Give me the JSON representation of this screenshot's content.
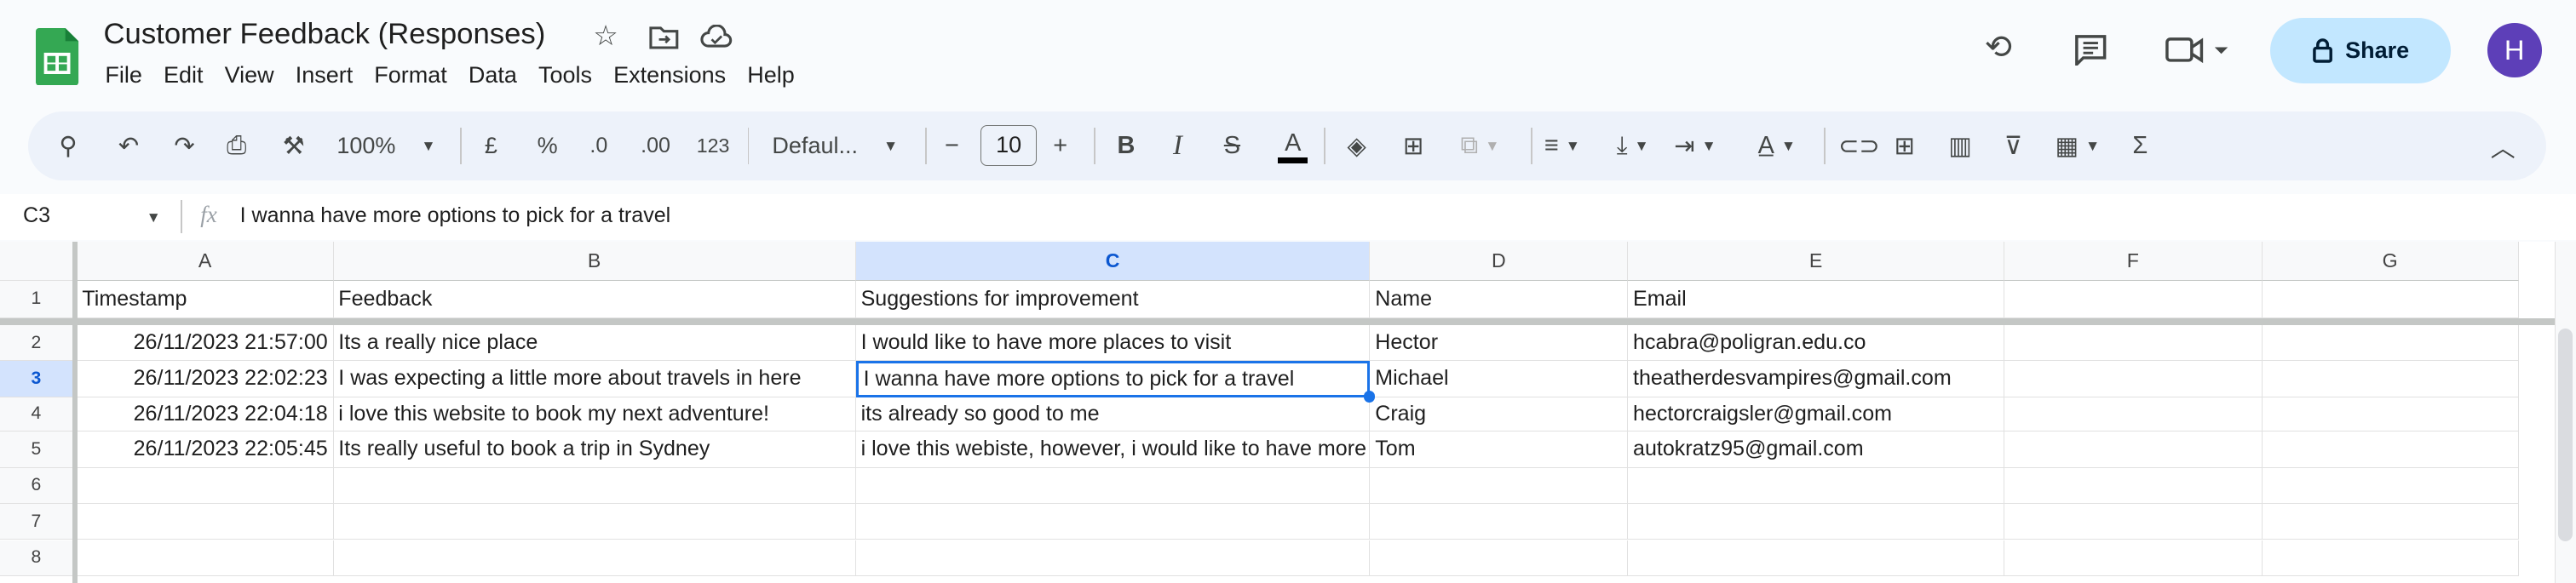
{
  "app": {
    "title": "Customer Feedback (Responses)",
    "menu": [
      "File",
      "Edit",
      "View",
      "Insert",
      "Format",
      "Data",
      "Tools",
      "Extensions",
      "Help"
    ],
    "share_label": "Share",
    "avatar_initial": "H",
    "brand_color": "#34a853",
    "share_bg": "#c2e7ff",
    "avatar_color": "#5d3fb8"
  },
  "toolbar": {
    "zoom": "100%",
    "currency": "£",
    "percent": "%",
    "decrease_decimal": ".0",
    "increase_decimal": ".00",
    "number_format": "123",
    "font": "Defaul...",
    "font_size": "10",
    "bold": "B",
    "italic": "I",
    "strikethrough": "S",
    "text_color": "A",
    "sum": "Σ"
  },
  "formula_bar": {
    "cell_ref": "C3",
    "fx": "fx",
    "value": "I wanna have more options to pick for a travel"
  },
  "sheet": {
    "columns": [
      "A",
      "B",
      "C",
      "D",
      "E",
      "F",
      "G"
    ],
    "selected_column": "C",
    "selected_row": 3,
    "row_numbers": [
      "1",
      "2",
      "3",
      "4",
      "5",
      "6",
      "7",
      "8"
    ],
    "rows": [
      [
        "Timestamp",
        "Feedback",
        "Suggestions for improvement",
        "Name",
        "Email",
        "",
        ""
      ],
      [
        "26/11/2023 21:57:00",
        "Its a really nice place",
        "I would like to have more places to visit",
        "Hector",
        "hcabra@poligran.edu.co",
        "",
        ""
      ],
      [
        "26/11/2023 22:02:23",
        "I was expecting a little more about travels in here",
        "I wanna have more options to pick for a travel",
        "Michael",
        "theatherdesvampires@gmail.com",
        "",
        ""
      ],
      [
        "26/11/2023 22:04:18",
        "i love this website to book my next adventure!",
        "its already so good to me",
        "Craig",
        "hectorcraigsler@gmail.com",
        "",
        ""
      ],
      [
        "26/11/2023 22:05:45",
        "Its really useful to book a trip in Sydney",
        "i love this webiste, however, i would like to have more",
        "Tom",
        "autokratz95@gmail.com",
        "",
        ""
      ],
      [
        "",
        "",
        "",
        "",
        "",
        "",
        ""
      ],
      [
        "",
        "",
        "",
        "",
        "",
        "",
        ""
      ],
      [
        "",
        "",
        "",
        "",
        "",
        "",
        ""
      ]
    ]
  }
}
